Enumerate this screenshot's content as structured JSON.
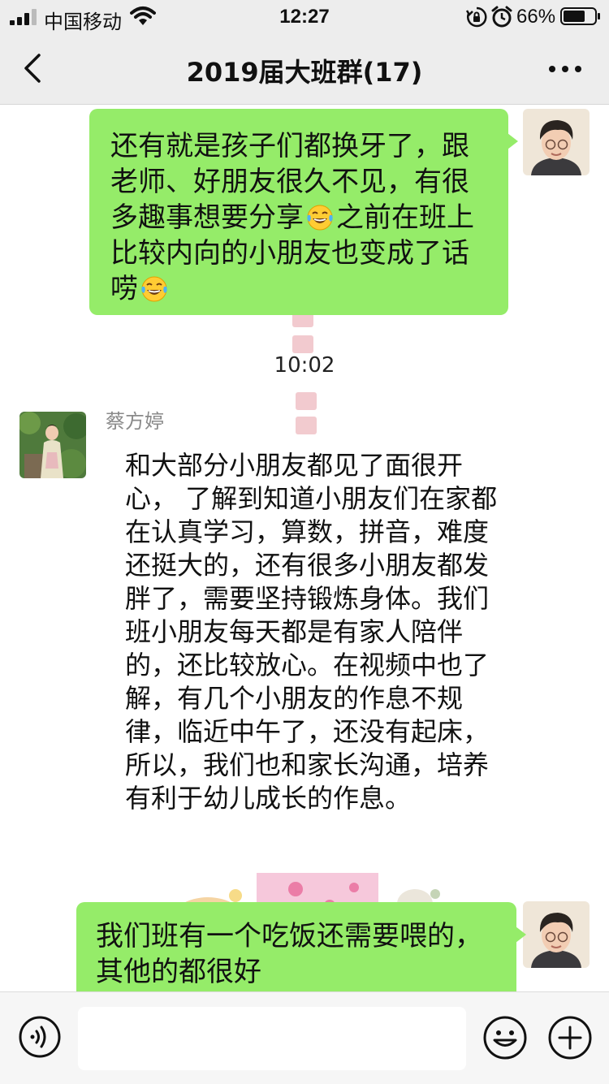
{
  "status_bar": {
    "carrier": "中国移动",
    "time": "12:27",
    "battery_percent": "66%",
    "icons": [
      "signal-icon",
      "wifi-icon",
      "rotation-lock-icon",
      "alarm-icon",
      "battery-icon"
    ]
  },
  "nav": {
    "title": "2019届大班群(17)",
    "icons": [
      "back-icon",
      "more-icon"
    ]
  },
  "messages": [
    {
      "direction": "sent",
      "parts": [
        "还有就是孩子们都换牙了，跟老师、好朋友很久不见，有很多趣事想要分享",
        "之前在班上比较内向的小朋友也变成了话唠"
      ],
      "emoji": "tears-of-joy-emoji"
    },
    {
      "direction": "received",
      "sender": "蔡方婷",
      "text": "和大部分小朋友都见了面很开心， 了解到知道小朋友们在家都在认真学习，算数，拼音，难度还挺大的，还有很多小朋友都发胖了，需要坚持锻炼身体。我们班小朋友每天都是有家人陪伴的，还比较放心。在视频中也了解，有几个小朋友的作息不规律，临近中午了，还没有起床，所以，我们也和家长沟通，培养有利于幼儿成长的作息。"
    },
    {
      "direction": "sent",
      "text": "我们班有一个吃饭还需要喂的，其他的都很好"
    }
  ],
  "timestamp": "10:02",
  "input_bar": {
    "value": "",
    "icons": [
      "voice-icon",
      "emoji-icon",
      "plus-icon"
    ]
  },
  "colors": {
    "sent_bubble": "#95ec69",
    "nav_background": "#ededed",
    "chat_background": "#ffffff"
  }
}
